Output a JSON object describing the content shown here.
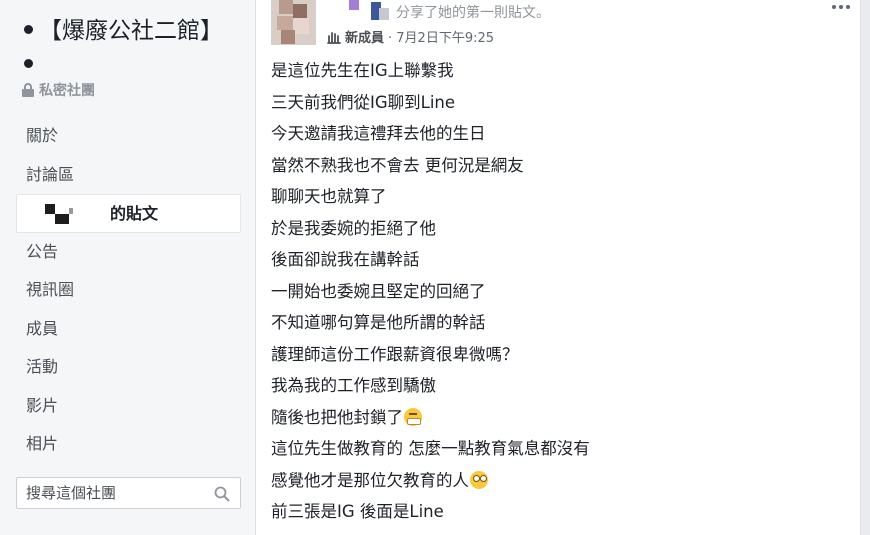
{
  "group": {
    "title": "【爆廢公社二館】",
    "privacy": "私密社團"
  },
  "nav": {
    "items": [
      "關於",
      "討論區"
    ],
    "active_label": "的貼文",
    "items_after": [
      "公告",
      "視訊圈",
      "成員",
      "活動",
      "影片",
      "相片"
    ]
  },
  "search": {
    "placeholder": "搜尋這個社團"
  },
  "post": {
    "action": "分享了她的第一則貼文。",
    "badge": "新成員",
    "timestamp": "· 7月2日下午9:25",
    "lines": [
      "是這位先生在IG上聯繫我",
      "三天前我們從IG聊到Line",
      "今天邀請我這禮拜去他的生日",
      "當然不熟我也不會去 更何況是網友",
      "聊聊天也就算了",
      "於是我委婉的拒絕了他",
      "後面卻說我在講幹話",
      "一開始也委婉且堅定的回絕了",
      "不知道哪句算是他所謂的幹話",
      "護理師這份工作跟薪資很卑微嗎？",
      "我為我的工作感到驕傲",
      "隨後也把他封鎖了",
      "這位先生做教育的 怎麼一點教育氣息都沒有",
      "感覺他才是那位欠教育的人",
      "前三張是IG 後面是Line"
    ]
  },
  "colors": {
    "sidebar_bg": "#f5f6f7",
    "page_bg": "#e9ebee",
    "text": "#1d2129",
    "muted": "#90949c"
  }
}
